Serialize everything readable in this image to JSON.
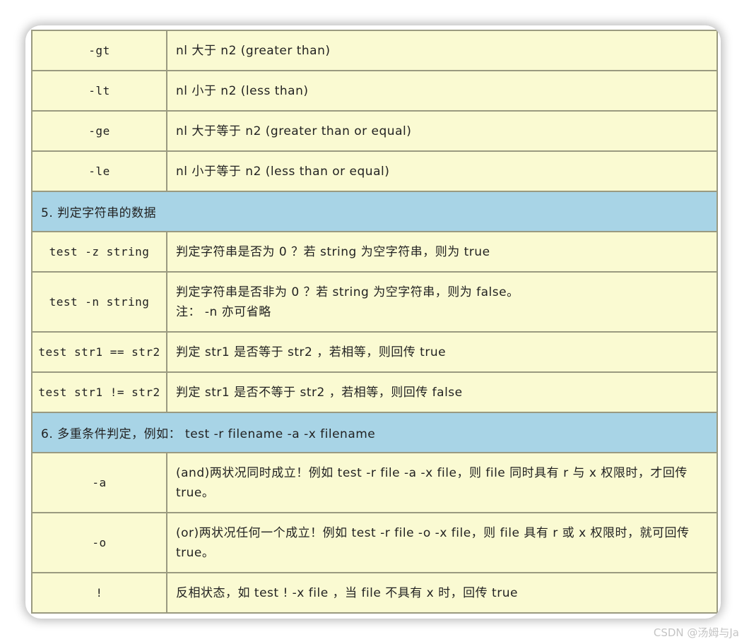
{
  "rows": [
    {
      "type": "item",
      "key": "-gt",
      "desc": "nl 大于 n2 (greater than)"
    },
    {
      "type": "item",
      "key": "-lt",
      "desc": "nl 小于 n2 (less than)"
    },
    {
      "type": "item",
      "key": "-ge",
      "desc": "nl 大于等于 n2 (greater than or equal)"
    },
    {
      "type": "item",
      "key": "-le",
      "desc": "nl 小于等于 n2 (less than or equal)"
    },
    {
      "type": "section",
      "title": "5. 判定字符串的数据"
    },
    {
      "type": "item",
      "key": "test -z string",
      "desc": "判定字符串是否为 0 ？若 string 为空字符串，则为 true"
    },
    {
      "type": "item",
      "key": "test -n string",
      "desc": "判定字符串是否非为 0 ？若 string 为空字符串，则为 false。",
      "desc2": "注： -n 亦可省略"
    },
    {
      "type": "item",
      "key": "test str1 == str2",
      "desc": "判定 str1 是否等于 str2 ，若相等，则回传 true"
    },
    {
      "type": "item",
      "key": "test str1 != str2",
      "desc": "判定 str1 是否不等于 str2 ，若相等，则回传 false"
    },
    {
      "type": "section",
      "title": "6. 多重条件判定，例如： test -r filename -a -x filename"
    },
    {
      "type": "item",
      "key": "-a",
      "desc": "(and)两状况同时成立！例如 test -r file -a -x file，则 file 同时具有 r 与 x 权限时，才回传 true。"
    },
    {
      "type": "item",
      "key": "-o",
      "desc": "(or)两状况任何一个成立！例如 test -r file -o -x file，则 file 具有 r 或 x 权限时，就可回传 true。"
    },
    {
      "type": "item",
      "key": "!",
      "desc": "反相状态，如 test ! -x file ，当 file 不具有 x 时，回传 true"
    }
  ],
  "watermark": "CSDN @汤姆与Ja"
}
